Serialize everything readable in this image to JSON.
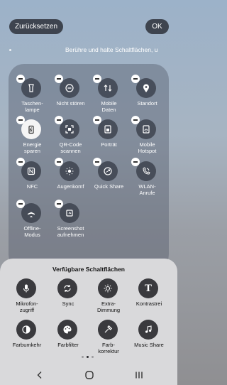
{
  "topbar": {
    "reset_label": "Zurücksetzen",
    "ok_label": "OK"
  },
  "hint": "Berühre und halte Schaltflächen, u",
  "active_tiles": [
    {
      "label": "Taschen-\nlampe",
      "icon": "flashlight-icon"
    },
    {
      "label": "Nicht stören",
      "icon": "do-not-disturb-icon"
    },
    {
      "label": "Mobile\nDaten",
      "icon": "mobile-data-icon"
    },
    {
      "label": "Standort",
      "icon": "location-icon"
    },
    {
      "label": "Energie\nsparen",
      "icon": "battery-saver-icon"
    },
    {
      "label": "QR-Code\nscannen",
      "icon": "qr-scan-icon"
    },
    {
      "label": "Porträt",
      "icon": "portrait-icon"
    },
    {
      "label": "Mobile\nHotspot",
      "icon": "hotspot-icon"
    },
    {
      "label": "NFC",
      "icon": "nfc-icon"
    },
    {
      "label": "Augenkomf",
      "icon": "eye-comfort-icon"
    },
    {
      "label": "Quick Share",
      "icon": "quick-share-icon"
    },
    {
      "label": "WLAN-\nAnrufe",
      "icon": "wifi-calling-icon"
    },
    {
      "label": "Offline-\nModus",
      "icon": "airplane-icon"
    },
    {
      "label": "Screenshot\naufnehmen",
      "icon": "screenshot-icon"
    }
  ],
  "sheet": {
    "title": "Verfügbare Schaltflächen",
    "items": [
      {
        "label": "Mikrofon-\nzugriff",
        "icon": "microphone-icon"
      },
      {
        "label": "Sync",
        "icon": "sync-icon"
      },
      {
        "label": "Extra-\nDimmung",
        "icon": "extra-dim-icon"
      },
      {
        "label": "Kontrastrei",
        "icon": "text-contrast-icon"
      },
      {
        "label": "Farbumkehr",
        "icon": "color-inversion-icon"
      },
      {
        "label": "Farbfilter",
        "icon": "palette-icon"
      },
      {
        "label": "Farb-\nkorrektur",
        "icon": "color-correction-icon"
      },
      {
        "label": "Music Share",
        "icon": "music-share-icon"
      }
    ],
    "pages": 3,
    "current_page": 2
  },
  "navbar": {
    "back_icon": "back-icon",
    "home_icon": "home-icon",
    "recents_icon": "recents-icon"
  }
}
